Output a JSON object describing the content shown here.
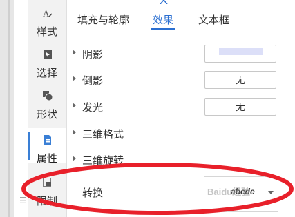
{
  "sidebar": {
    "items": [
      {
        "label": "样式",
        "icon": "style-icon"
      },
      {
        "label": "选择",
        "icon": "select-icon"
      },
      {
        "label": "形状",
        "icon": "shape-icon"
      },
      {
        "label": "属性",
        "icon": "properties-icon",
        "active": true
      },
      {
        "label": "限制",
        "icon": "lock-icon"
      }
    ]
  },
  "tabs": [
    {
      "label": "填充与轮廓"
    },
    {
      "label": "效果",
      "active": true
    },
    {
      "label": "文本框"
    }
  ],
  "effects": {
    "shadow_label": "阴影",
    "reflection_label": "倒影",
    "reflection_value": "无",
    "glow_label": "发光",
    "glow_value": "无",
    "format3d_label": "三维格式",
    "rotation3d_label": "三维旋转",
    "transform_label": "转换",
    "transform_preview_text": "abcde"
  },
  "colors": {
    "accent": "#2b6fd1",
    "annotation": "#e8202a",
    "shadow_swatch": "#dcdff8"
  },
  "watermark_text": "Baidu经验"
}
